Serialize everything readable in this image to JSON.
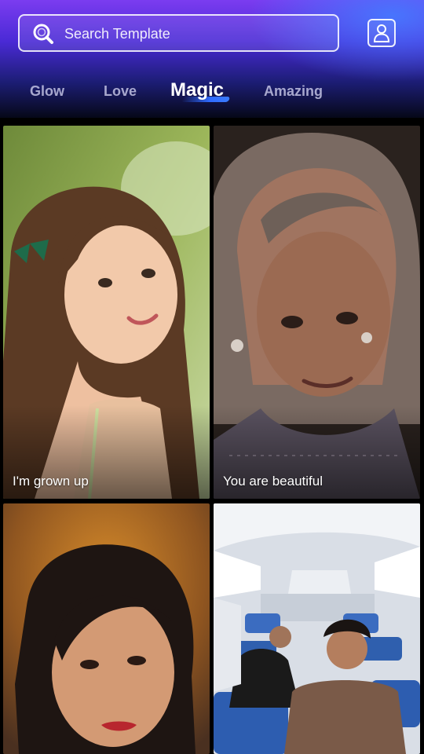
{
  "search": {
    "placeholder": "Search Template"
  },
  "tabs": [
    {
      "label": "Glow",
      "active": false
    },
    {
      "label": "Love",
      "active": false
    },
    {
      "label": "Magic",
      "active": true
    },
    {
      "label": "Amazing",
      "active": false
    }
  ],
  "templates": [
    {
      "label": "I'm grown up"
    },
    {
      "label": "You are beautiful"
    },
    {
      "label": ""
    },
    {
      "label": ""
    }
  ],
  "icons": {
    "search": "search-icon",
    "profile": "user-profile-icon"
  },
  "colors": {
    "accent": "#2f6bff",
    "header_top": "#7b3cf0",
    "header_bottom": "#060818"
  }
}
